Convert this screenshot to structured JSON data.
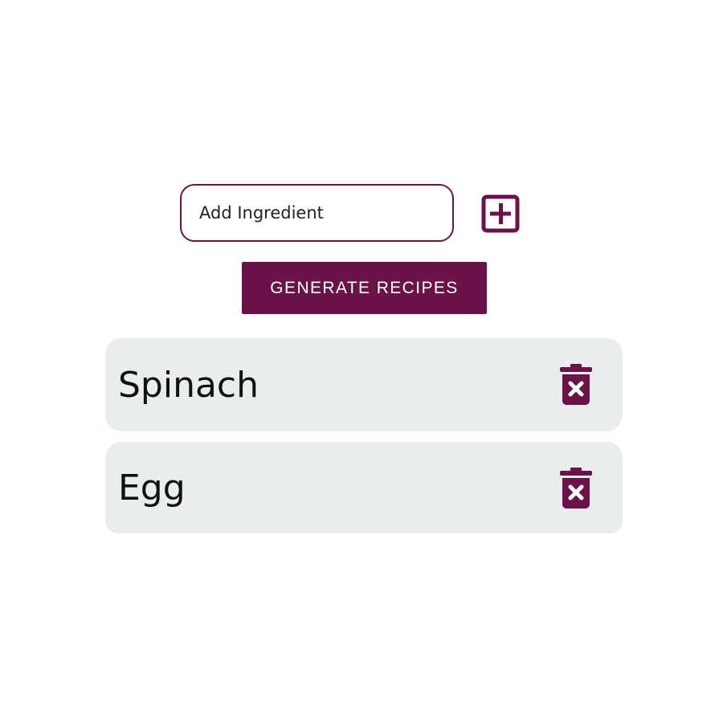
{
  "colors": {
    "accent": "#6b1249",
    "item_background": "#eaedee",
    "page_background": "#ffffff"
  },
  "form": {
    "ingredient_input": {
      "placeholder": "Add Ingredient",
      "value": ""
    },
    "add_button_icon": "plus-square-icon",
    "generate_label": "GENERATE RECIPES"
  },
  "ingredients": [
    {
      "name": "Spinach",
      "delete_icon": "trash-x-icon"
    },
    {
      "name": "Egg",
      "delete_icon": "trash-x-icon"
    }
  ]
}
